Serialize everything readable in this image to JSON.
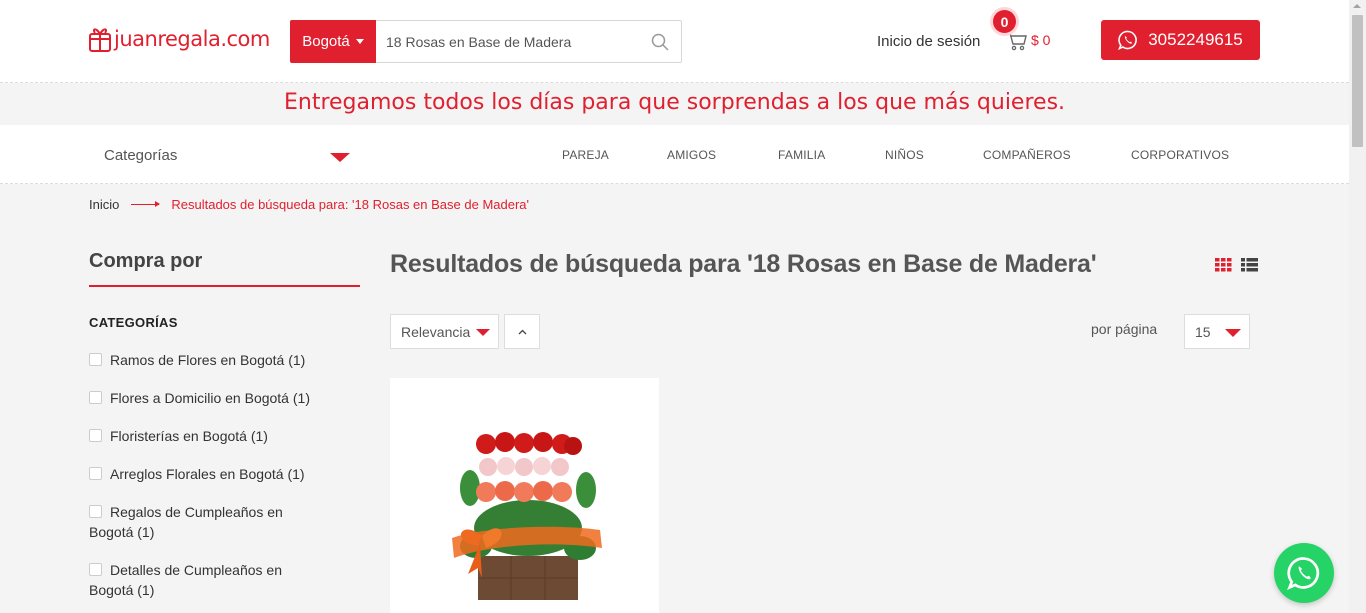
{
  "header": {
    "logo_text": "juanregala.com",
    "city": "Bogotá",
    "search_value": "18 Rosas en Base de Madera",
    "login_label": "Inicio de sesión",
    "cart_count": "0",
    "cart_total": "$ 0",
    "whatsapp_phone": "3052249615"
  },
  "banner": {
    "text": "Entregamos todos los días para que sorprendas a los que más quieres."
  },
  "nav": {
    "categories_label": "Categorías",
    "items": [
      "PAREJA",
      "AMIGOS",
      "FAMILIA",
      "NIÑOS",
      "COMPAÑEROS",
      "CORPORATIVOS"
    ]
  },
  "breadcrumb": {
    "home": "Inicio",
    "current": "Resultados de búsqueda para: '18 Rosas en Base de Madera'"
  },
  "sidebar": {
    "title": "Compra por",
    "categories_heading": "CATEGORÍAS",
    "filters": [
      {
        "label": "Ramos de Flores en Bogotá",
        "count": "(1)"
      },
      {
        "label": "Flores a Domicilio en Bogotá",
        "count": "(1)"
      },
      {
        "label": "Floristerías en Bogotá",
        "count": "(1)"
      },
      {
        "label": "Arreglos Florales en Bogotá",
        "count": "(1)"
      },
      {
        "label": "Regalos de Cumpleaños en Bogotá",
        "count": "(1)"
      },
      {
        "label": "Detalles de Cumpleaños en Bogotá",
        "count": "(1)"
      }
    ]
  },
  "results": {
    "title": "Resultados de búsqueda para '18 Rosas en Base de Madera'",
    "sort_value": "Relevancia",
    "per_page_label": "por página",
    "per_page_value": "15"
  },
  "colors": {
    "brand_red": "#e0202f",
    "whatsapp_green": "#25d366"
  }
}
